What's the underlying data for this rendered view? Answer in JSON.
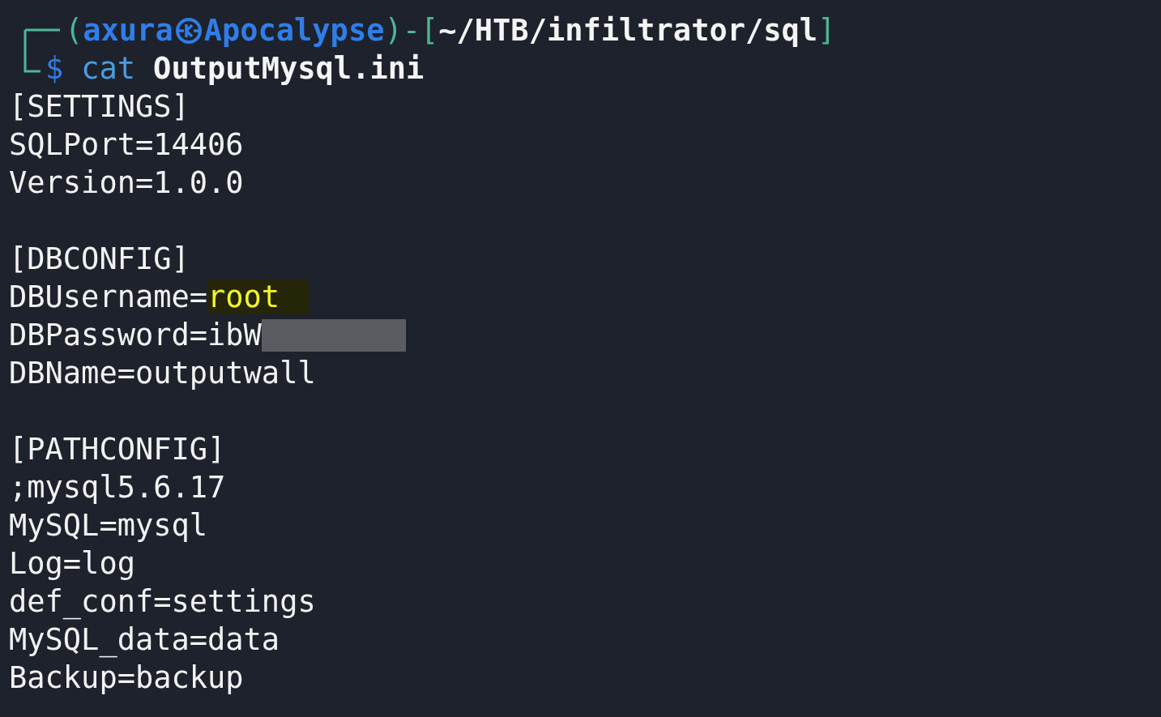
{
  "prompt": {
    "user": "axura",
    "host": "Apocalypse",
    "path": "~/HTB/infiltrator/sql",
    "open": "(",
    "separator": ")-[",
    "close": "]",
    "symbol": "$",
    "command": "cat",
    "argument": "OutputMysql.ini"
  },
  "output": [
    {
      "kind": "text",
      "text": "[SETTINGS]"
    },
    {
      "kind": "text",
      "text": "SQLPort=14406"
    },
    {
      "kind": "text",
      "text": "Version=1.0.0"
    },
    {
      "kind": "blank"
    },
    {
      "kind": "text",
      "text": "[DBCONFIG]"
    },
    {
      "kind": "highlight",
      "text": "DBUsername=",
      "value": "root"
    },
    {
      "kind": "redacted",
      "text": "DBPassword=ibW"
    },
    {
      "kind": "text",
      "text": "DBName=outputwall"
    },
    {
      "kind": "blank"
    },
    {
      "kind": "text",
      "text": "[PATHCONFIG]"
    },
    {
      "kind": "text",
      "text": ";mysql5.6.17"
    },
    {
      "kind": "text",
      "text": "MySQL=mysql"
    },
    {
      "kind": "text",
      "text": "Log=log"
    },
    {
      "kind": "text",
      "text": "def_conf=settings"
    },
    {
      "kind": "text",
      "text": "MySQL_data=data"
    },
    {
      "kind": "text",
      "text": "Backup=backup"
    }
  ]
}
